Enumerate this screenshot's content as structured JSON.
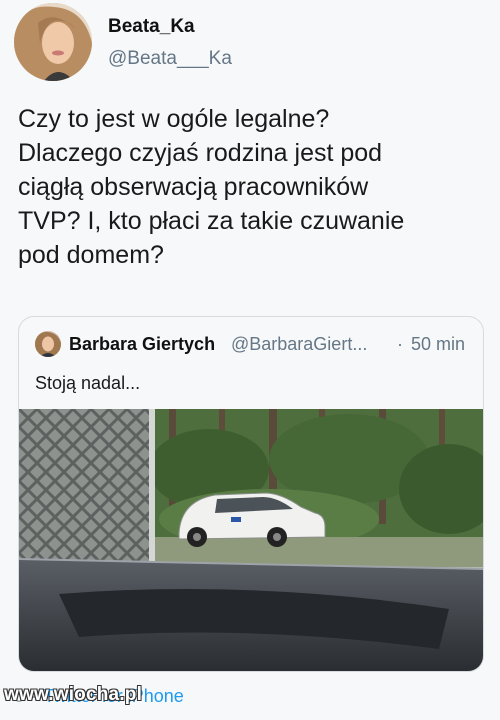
{
  "author": {
    "display_name": "Beata_Ka",
    "handle": "@Beata___Ka",
    "avatar": "woman-portrait-avatar"
  },
  "tweet": {
    "text": "Czy to jest w ogóle legalne?\nDlaczego czyjaś rodzina jest pod\nciągłą obserwacją pracowników\nTVP? I, kto płaci za takie czuwanie\npod domem?"
  },
  "quoted_tweet": {
    "display_name": "Barbara Giertych",
    "handle": "@BarbaraGiert...",
    "separator": "·",
    "time": "50 min",
    "text": "Stoją nadal...",
    "photo": "white-station-wagon-parked-by-forest-seen-through-car-windshield"
  },
  "footer": {
    "time_partial": "0",
    "separator": "·",
    "via": "Twitter for iPhone"
  },
  "watermark": {
    "text": "www.wiocha.pl"
  },
  "colors": {
    "background": "#f7f8f9",
    "muted": "#657786",
    "link": "#1d9bf0",
    "border": "#d6dbe0"
  }
}
